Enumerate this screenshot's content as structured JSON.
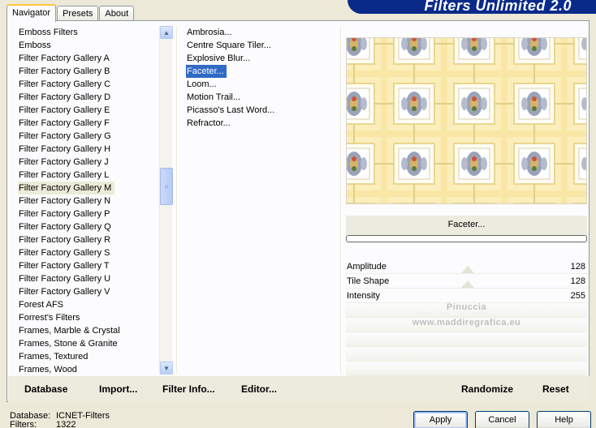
{
  "window": {
    "banner": "Filters Unlimited 2.0"
  },
  "tabs": [
    {
      "label": "Navigator"
    },
    {
      "label": "Presets"
    },
    {
      "label": "About"
    }
  ],
  "categories": {
    "items": [
      "Emboss Filters",
      "Emboss",
      "Filter Factory Gallery A",
      "Filter Factory Gallery B",
      "Filter Factory Gallery C",
      "Filter Factory Gallery D",
      "Filter Factory Gallery E",
      "Filter Factory Gallery F",
      "Filter Factory Gallery G",
      "Filter Factory Gallery H",
      "Filter Factory Gallery J",
      "Filter Factory Gallery L",
      "Filter Factory Gallery M",
      "Filter Factory Gallery N",
      "Filter Factory Gallery P",
      "Filter Factory Gallery Q",
      "Filter Factory Gallery R",
      "Filter Factory Gallery S",
      "Filter Factory Gallery T",
      "Filter Factory Gallery U",
      "Filter Factory Gallery V",
      "Forest AFS",
      "Forrest's Filters",
      "Frames, Marble & Crystal",
      "Frames, Stone & Granite",
      "Frames, Textured",
      "Frames, Wood"
    ],
    "selected": "Filter Factory Gallery M"
  },
  "filters": {
    "items": [
      "Ambrosia...",
      "Centre Square Tiler...",
      "Explosive Blur...",
      "Faceter...",
      "Loom...",
      "Motion Trail...",
      "Picasso's Last Word...",
      "Refractor..."
    ],
    "selected": "Faceter..."
  },
  "preview": {
    "filter_name": "Faceter..."
  },
  "params": [
    {
      "label": "Amplitude",
      "value": "128"
    },
    {
      "label": "Tile Shape",
      "value": "128"
    },
    {
      "label": "Intensity",
      "value": "255"
    }
  ],
  "watermark": {
    "line1": "Pinuccia",
    "line2": "www.maddiregrafica.eu"
  },
  "toolbar": {
    "database": "Database",
    "import": "Import...",
    "filter_info": "Filter Info...",
    "editor": "Editor...",
    "randomize": "Randomize",
    "reset": "Reset"
  },
  "footer": {
    "database_label": "Database:",
    "database_value": "ICNET-Filters",
    "filters_label": "Filters:",
    "filters_value": "1322"
  },
  "buttons": {
    "apply": "Apply",
    "cancel": "Cancel",
    "help": "Help"
  }
}
